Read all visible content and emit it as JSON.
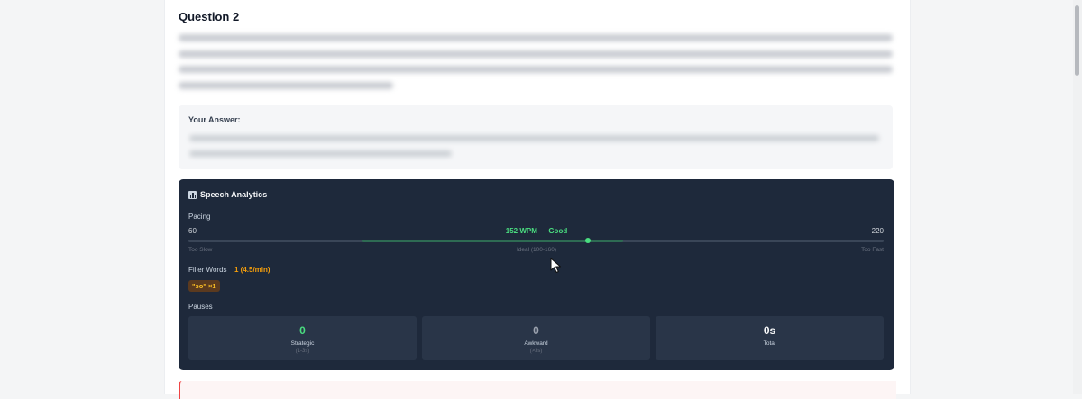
{
  "question": {
    "title": "Question 2"
  },
  "answer": {
    "label": "Your Answer:"
  },
  "analytics": {
    "title": "Speech Analytics",
    "title_icon": "bar-chart-icon",
    "pacing": {
      "label": "Pacing",
      "min_label": "60",
      "max_label": "220",
      "min": 60,
      "max": 220,
      "wpm": 152,
      "value_label": "152 WPM — Good",
      "ideal_min": 100,
      "ideal_max": 160,
      "scale_left": "Too Slow",
      "scale_mid": "Ideal (100-160)",
      "scale_right": "Too Fast"
    },
    "filler": {
      "label": "Filler Words",
      "count": "1 (4.5/min)",
      "chips": [
        "\"so\" ×1"
      ]
    },
    "pauses": {
      "label": "Pauses",
      "items": [
        {
          "value": "0",
          "name": "Strategic",
          "sub": "(1-3s)",
          "color": "#4ade80"
        },
        {
          "value": "0",
          "name": "Awkward",
          "sub": "(>3s)",
          "color": "#9ca3af"
        },
        {
          "value": "0s",
          "name": "Total",
          "sub": "",
          "color": "#f9fafb"
        }
      ]
    }
  },
  "colors": {
    "accent_good": "#4ade80",
    "filler": "#f59e0b",
    "panel_bg": "#1e293b",
    "next_border": "#ef4444"
  }
}
